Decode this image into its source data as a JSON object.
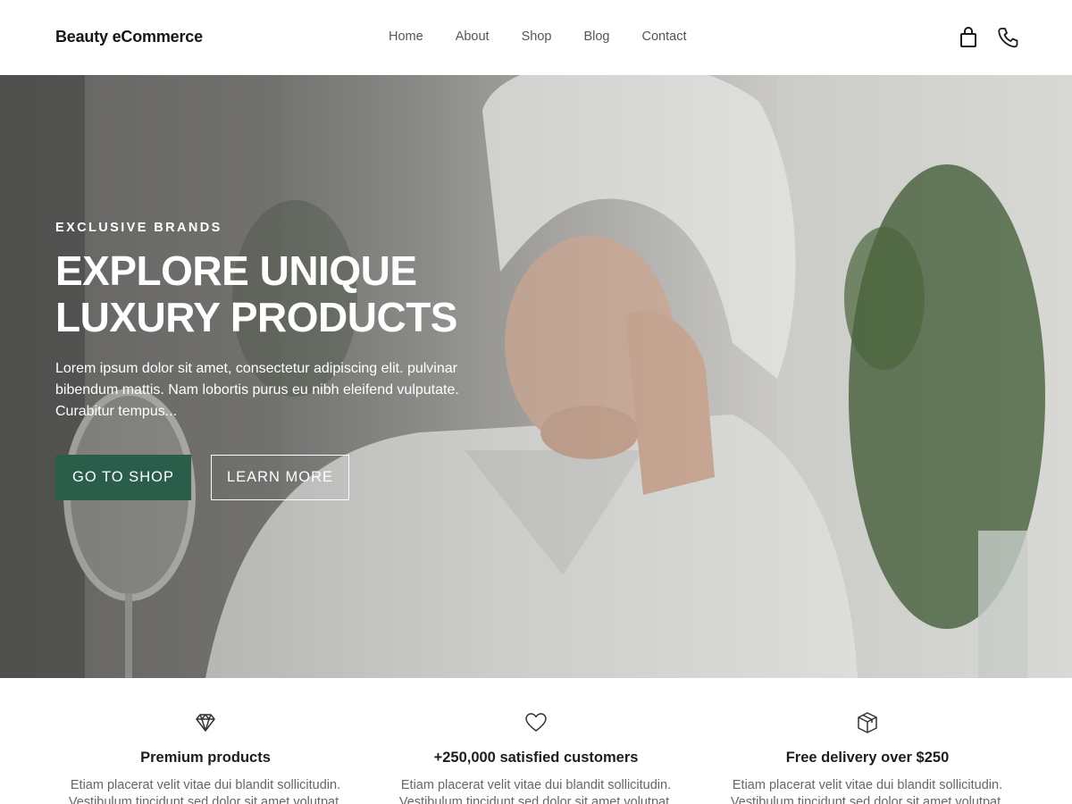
{
  "header": {
    "brand": "Beauty eCommerce",
    "nav": [
      "Home",
      "About",
      "Shop",
      "Blog",
      "Contact"
    ],
    "icons": [
      "shopping-bag-icon",
      "phone-icon"
    ]
  },
  "hero": {
    "eyebrow": "EXCLUSIVE BRANDS",
    "headline": [
      "EXPLORE UNIQUE",
      "LUXURY PRODUCTS"
    ],
    "lede": "Lorem ipsum dolor sit amet, consectetur adipiscing elit. pulvinar bibendum mattis. Nam lobortis purus eu nibh eleifend vulputate. Curabitur tempus...",
    "primary_cta": "GO TO SHOP",
    "secondary_cta": "LEARN MORE",
    "primary_color": "#2b5d4b"
  },
  "features": [
    {
      "icon": "diamond-icon",
      "title": "Premium products",
      "text": "Etiam placerat velit vitae dui blandit sollicitudin. Vestibulum tincidunt sed dolor sit amet volutpat."
    },
    {
      "icon": "heart-icon",
      "title": "+250,000 satisfied customers",
      "text": "Etiam placerat velit vitae dui blandit sollicitudin. Vestibulum tincidunt sed dolor sit amet volutpat."
    },
    {
      "icon": "package-icon",
      "title": "Free delivery over $250",
      "text": "Etiam placerat velit vitae dui blandit sollicitudin. Vestibulum tincidunt sed dolor sit amet volutpat."
    }
  ]
}
